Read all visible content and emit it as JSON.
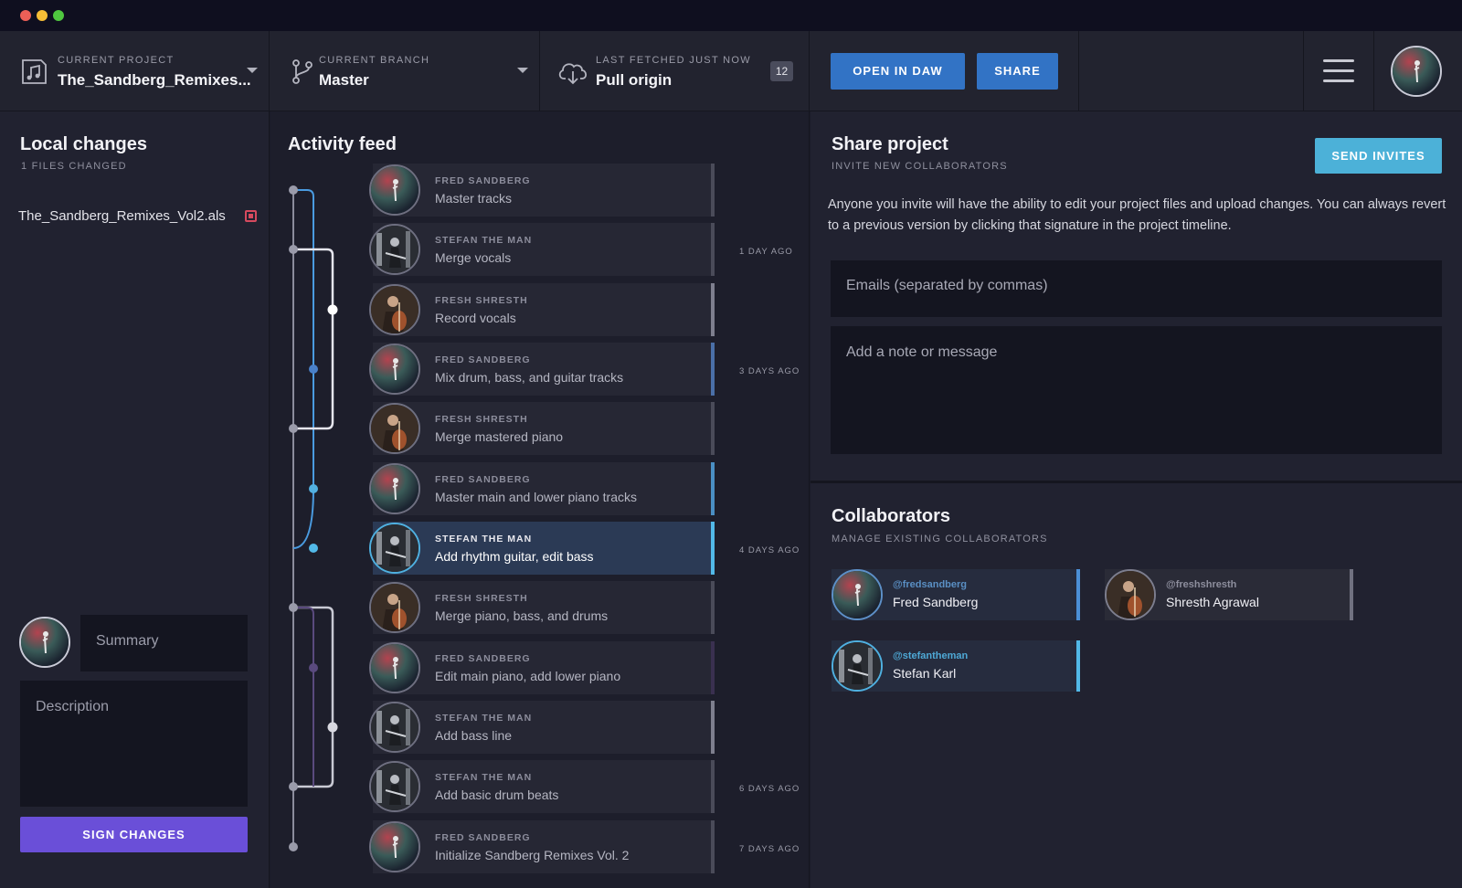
{
  "toolbar": {
    "project_label": "CURRENT PROJECT",
    "project_value": "The_Sandberg_Remixes...",
    "branch_label": "CURRENT BRANCH",
    "branch_value": "Master",
    "fetch_label": "LAST FETCHED JUST NOW",
    "fetch_value": "Pull origin",
    "fetch_count": "12",
    "open_daw": "OPEN IN DAW",
    "share": "SHARE"
  },
  "local": {
    "title": "Local changes",
    "subtitle": "1 FILES CHANGED",
    "file": "The_Sandberg_Remixes_Vol2.als",
    "summary_placeholder": "Summary",
    "description_placeholder": "Description",
    "sign_button": "SIGN CHANGES"
  },
  "feed": {
    "title": "Activity feed",
    "items": [
      {
        "author": "FRED SANDBERG",
        "message": "Master tracks"
      },
      {
        "author": "STEFAN THE MAN",
        "message": "Merge vocals"
      },
      {
        "author": "FRESH SHRESTH",
        "message": "Record vocals"
      },
      {
        "author": "FRED SANDBERG",
        "message": "Mix drum, bass, and guitar tracks"
      },
      {
        "author": "FRESH SHRESTH",
        "message": "Merge mastered piano"
      },
      {
        "author": "FRED SANDBERG",
        "message": "Master main and lower piano tracks"
      },
      {
        "author": "STEFAN THE MAN",
        "message": "Add rhythm guitar, edit bass"
      },
      {
        "author": "FRESH SHRESTH",
        "message": "Merge piano, bass, and drums"
      },
      {
        "author": "FRED SANDBERG",
        "message": "Edit main piano, add lower piano"
      },
      {
        "author": "STEFAN THE MAN",
        "message": "Add bass line"
      },
      {
        "author": "STEFAN THE MAN",
        "message": "Add basic drum beats"
      },
      {
        "author": "FRED SANDBERG",
        "message": "Initialize Sandberg Remixes Vol. 2"
      }
    ],
    "dates": [
      "1 DAY AGO",
      "3 DAYS AGO",
      "4 DAYS AGO",
      "6 DAYS AGO",
      "7 DAYS AGO"
    ]
  },
  "share": {
    "title": "Share project",
    "subtitle": "INVITE NEW COLLABORATORS",
    "send_button": "SEND INVITES",
    "description": "Anyone you invite will have the ability to edit your project files and upload changes. You can always revert to a previous version by clicking that signature in the project timeline.",
    "emails_placeholder": "Emails (separated by commas)",
    "note_placeholder": "Add a note or message"
  },
  "collaborators": {
    "title": "Collaborators",
    "subtitle": "MANAGE EXISTING COLLABORATORS",
    "items": [
      {
        "handle": "@fredsandberg",
        "name": "Fred Sandberg"
      },
      {
        "handle": "@freshshresth",
        "name": "Shresth Agrawal"
      },
      {
        "handle": "@stefantheman",
        "name": "Stefan Karl"
      }
    ]
  },
  "colors": {
    "accent_blue": "#3273c5",
    "send_teal": "#4cb1d8",
    "sign_purple": "#6a4fd8",
    "graph_blue": "#4a9be0"
  }
}
